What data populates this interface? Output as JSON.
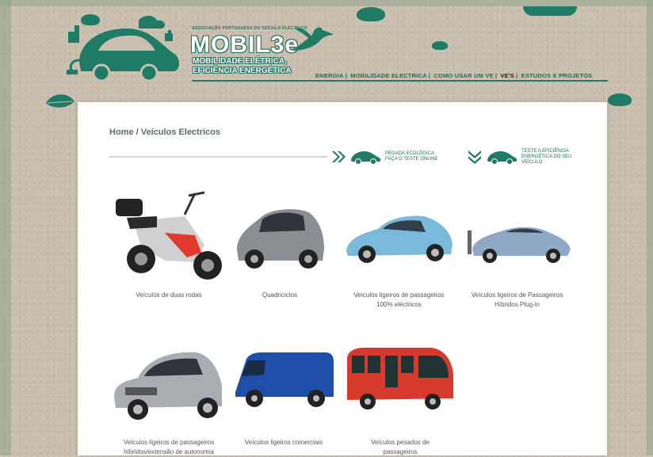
{
  "header": {
    "association": "ASSOCIAÇÃO PORTUGUESA DO VEÍCULO ELÉCTRICO",
    "brand": "MOBIL3e",
    "tagline_1": "MOBILIDADE ELÉTRICA,",
    "tagline_2": "EFICIÊNCIA ENERGÉTICA"
  },
  "nav": {
    "items": [
      {
        "label": "ENERGIA"
      },
      {
        "label": "MOBILIDADE ELECTRICA"
      },
      {
        "label": "COMO USAR UM VE"
      },
      {
        "label": "VE'S"
      },
      {
        "label": "ESTUDOS E PROJETOS"
      }
    ],
    "separator": "|"
  },
  "breadcrumb": "Home / Veículos Electricos",
  "promos": [
    {
      "text_1": "PEGADA ECOLÓGICA",
      "text_2": "FAÇA O TESTE ONLINE",
      "text_3": ""
    },
    {
      "text_1": "TESTE A EFICIÊNCIA",
      "text_2": "ENERGÉTICA DO SEU",
      "text_3": "VEÍCULO"
    }
  ],
  "vehicles": [
    {
      "label_1": "Veículos de duas rodas",
      "label_2": ""
    },
    {
      "label_1": "Quadriciclos",
      "label_2": ""
    },
    {
      "label_1": "Veículos ligeiros de passageiros",
      "label_2": "100% eléctricos"
    },
    {
      "label_1": "Veículos ligeiros de Passageiros",
      "label_2": "Híbridos Plug-in"
    },
    {
      "label_1": "Veículos ligeiros de passageiros",
      "label_2": "híbridos/extensão de autonomia"
    },
    {
      "label_1": "Veículos ligeiros comerciais",
      "label_2": ""
    },
    {
      "label_1": "Veículos pesados de",
      "label_2": "passageiros"
    }
  ],
  "colors": {
    "brand_green": "#1f7a66",
    "background": "#c9bfae",
    "panel": "#ffffff"
  }
}
